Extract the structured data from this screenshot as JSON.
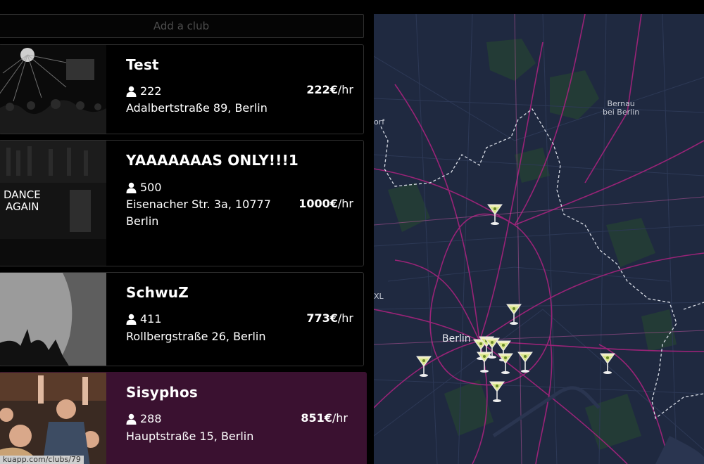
{
  "add_club": {
    "label": "Add a club"
  },
  "clubs": [
    {
      "name": "Test",
      "capacity": "222",
      "address": "Adalbertstraße 89, Berlin",
      "price_value": "222€",
      "price_unit": "/hr"
    },
    {
      "name": "YAAAAAAAS ONLY!!!1",
      "capacity": "500",
      "address": "Eisenacher Str. 3a, 10777 Berlin",
      "price_value": "1000€",
      "price_unit": "/hr",
      "thumb_text": [
        "DANCE",
        "AGAIN"
      ]
    },
    {
      "name": "SchwuZ",
      "capacity": "411",
      "address": "Rollbergstraße 26, Berlin",
      "price_value": "773€",
      "price_unit": "/hr"
    },
    {
      "name": "Sisyphos",
      "capacity": "288",
      "address": "Hauptstraße 15, Berlin",
      "price_value": "851€",
      "price_unit": "/hr",
      "selected": true
    }
  ],
  "status_bar": {
    "url": "kuapp.com/clubs/79"
  },
  "map": {
    "labels": {
      "berlin": "Berlin",
      "bernau": "Bernau\nbei Berlin",
      "edge_orf": "orf",
      "edge_xl": "XL"
    },
    "colors": {
      "background": "#1f2940",
      "roads": "#a0237a",
      "selected_card": "#3a1130"
    },
    "pin_icon": "martini-glass-icon",
    "pin_count": 12
  }
}
